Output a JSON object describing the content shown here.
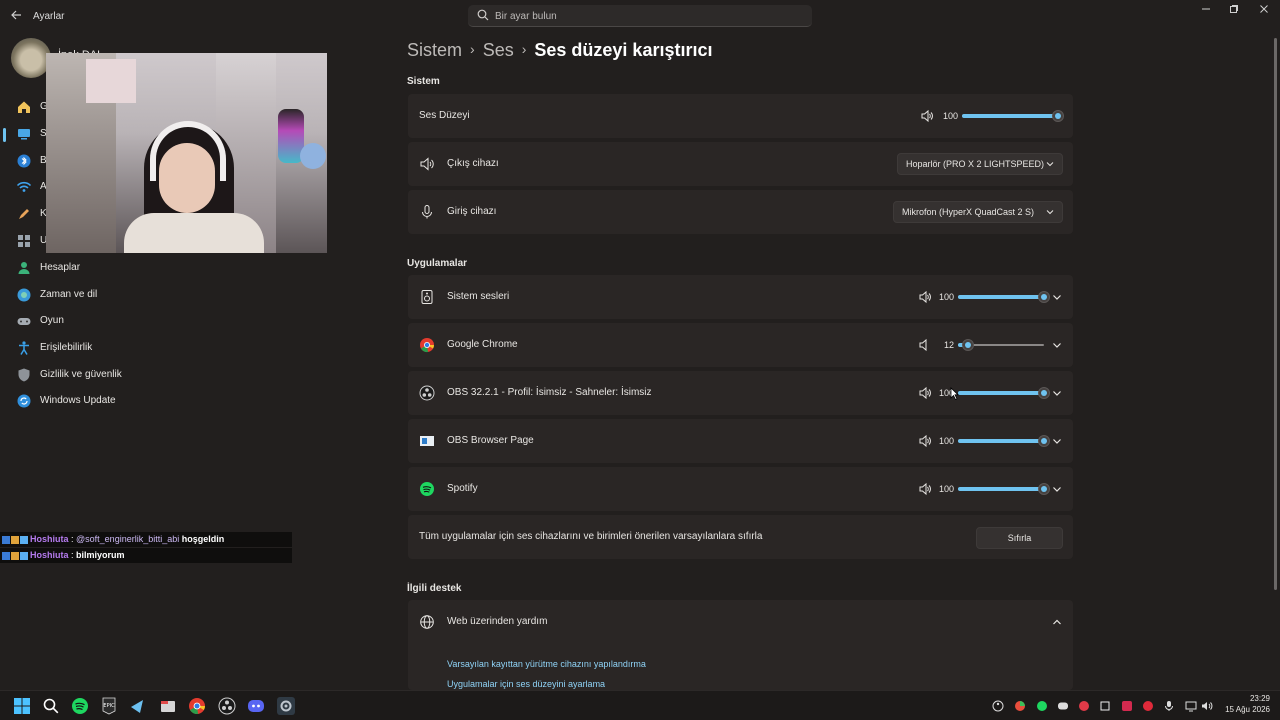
{
  "window": {
    "title": "Ayarlar",
    "search_placeholder": "Bir ayar bulun"
  },
  "user": {
    "name": "İpek DAL"
  },
  "sidebar": {
    "items": [
      {
        "label": "G",
        "icon": "home-icon"
      },
      {
        "label": "S",
        "icon": "system-icon"
      },
      {
        "label": "B",
        "icon": "bluetooth-icon"
      },
      {
        "label": "A",
        "icon": "network-icon"
      },
      {
        "label": "K",
        "icon": "personalization-icon"
      },
      {
        "label": "U",
        "icon": "apps-icon"
      },
      {
        "label": "Hesaplar",
        "icon": "accounts-icon"
      },
      {
        "label": "Zaman ve dil",
        "icon": "time-language-icon"
      },
      {
        "label": "Oyun",
        "icon": "gaming-icon"
      },
      {
        "label": "Erişilebilirlik",
        "icon": "accessibility-icon"
      },
      {
        "label": "Gizlilik ve güvenlik",
        "icon": "privacy-shield-icon"
      },
      {
        "label": "Windows Update",
        "icon": "windows-update-icon"
      }
    ]
  },
  "chat": [
    {
      "user": "Hoshiuta",
      "mention": "@soft_enginerlik_bitti_abi",
      "message": "hoşgeldin"
    },
    {
      "user": "Hoshiuta",
      "mention": "",
      "message": "bilmiyorum"
    }
  ],
  "breadcrumb": {
    "items": [
      "Sistem",
      "Ses"
    ],
    "current": "Ses düzeyi karıştırıcı"
  },
  "system_section": {
    "title": "Sistem",
    "volume": {
      "label": "Ses Düzeyi",
      "value": "100",
      "level": 100
    },
    "output": {
      "label": "Çıkış cihazı",
      "device": "Hoparlör (PRO X 2 LIGHTSPEED)"
    },
    "input": {
      "label": "Giriş cihazı",
      "device": "Mikrofon (HyperX QuadCast 2 S)"
    }
  },
  "apps_section": {
    "title": "Uygulamalar",
    "apps": [
      {
        "name": "Sistem sesleri",
        "value": "100",
        "level": 100,
        "icon": "system-sounds-icon"
      },
      {
        "name": "Google Chrome",
        "value": "12",
        "level": 12,
        "icon": "chrome-icon"
      },
      {
        "name": "OBS 32.2.1 - Profil: İsimsiz - Sahneler: İsimsiz",
        "value": "100",
        "level": 100,
        "icon": "obs-icon"
      },
      {
        "name": "OBS Browser Page",
        "value": "100",
        "level": 100,
        "icon": "obs-browser-icon"
      },
      {
        "name": "Spotify",
        "value": "100",
        "level": 100,
        "icon": "spotify-icon"
      }
    ],
    "reset_text": "Tüm uygulamalar için ses cihazlarını ve birimleri önerilen varsayılanlara sıfırla",
    "reset_button": "Sıfırla"
  },
  "support_section": {
    "title": "İlgili destek",
    "web_help": "Web üzerinden yardım",
    "links": [
      "Varsayılan kayıttan yürütme cihazını yapılandırma",
      "Uygulamalar için ses düzeyini ayarlama"
    ]
  },
  "clock": {
    "time": "23:29",
    "date": "15 Ağu 2026"
  },
  "colors": {
    "accent": "#6fc3f0",
    "background": "#221f1e",
    "card": "#2a2625"
  }
}
